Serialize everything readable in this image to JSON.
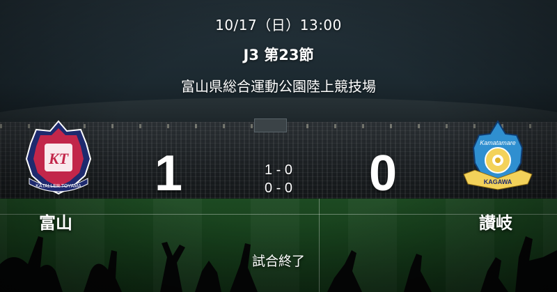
{
  "match": {
    "datetime": "10/17（日）13:00",
    "competition": "J3 第23節",
    "venue": "富山県総合運動公園陸上競技場",
    "status": "試合終了"
  },
  "home": {
    "name": "富山",
    "score": "1",
    "logo_text": "KATALLER TOYAMA",
    "logo_monogram": "KT",
    "color": "#c2264a"
  },
  "away": {
    "name": "讃岐",
    "score": "0",
    "logo_text": "Kamatamare",
    "logo_banner": "KAGAWA",
    "color": "#2f8fd0"
  },
  "halves": {
    "first": "1 - 0",
    "second": "0 - 0"
  }
}
